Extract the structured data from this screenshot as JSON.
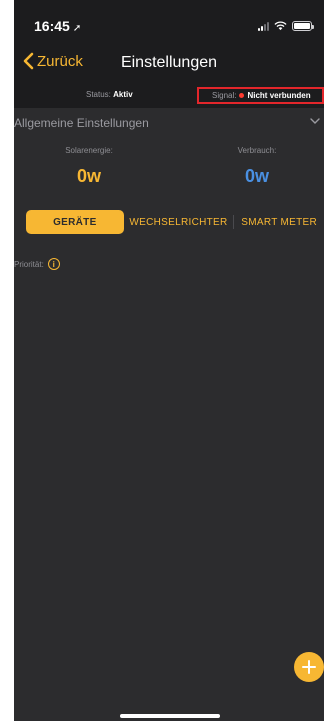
{
  "statusbar": {
    "time": "16:45",
    "location_glyph": "➚"
  },
  "nav": {
    "back_label": "Zurück",
    "title": "Einstellungen"
  },
  "status": {
    "status_label": "Status:",
    "status_value": "Aktiv",
    "signal_label": "Signal:",
    "signal_value": "Nicht verbunden",
    "signal_color": "#ff3b30"
  },
  "general": {
    "title": "Allgemeine Einstellungen",
    "solar_label": "Solarenergie:",
    "solar_value": "0w",
    "consumption_label": "Verbrauch:",
    "consumption_value": "0w"
  },
  "tabs": [
    {
      "label": "GERÄTE",
      "active": true
    },
    {
      "label": "WECHSELRICHTER",
      "active": false
    },
    {
      "label": "SMART METER",
      "active": false
    }
  ],
  "priority": {
    "label": "Priorität:",
    "info_glyph": "i"
  },
  "colors": {
    "accent": "#f7b733",
    "blue": "#4a90e2",
    "background": "#2c2c2e",
    "highlight_border": "#e3262b"
  }
}
